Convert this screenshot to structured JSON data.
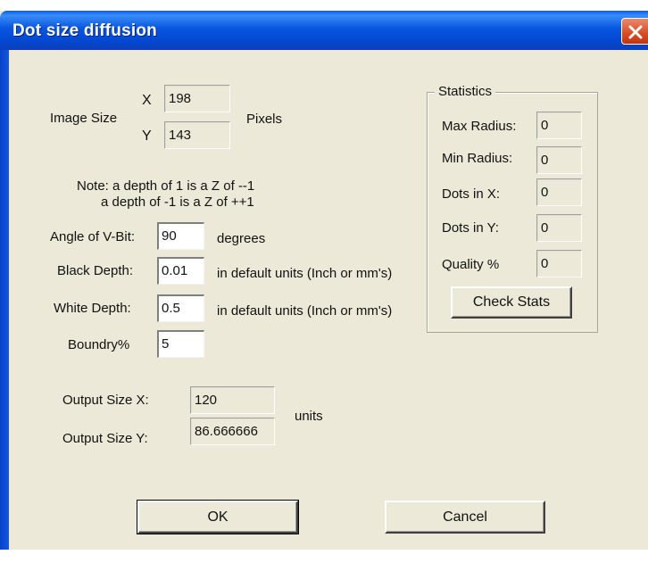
{
  "window": {
    "title": "Dot size diffusion"
  },
  "icons": {
    "close": "close-x-icon"
  },
  "image_size": {
    "label": "Image Size",
    "x_label": "X",
    "x_value": "198",
    "y_label": "Y",
    "y_value": "143",
    "unit": "Pixels"
  },
  "note": {
    "line1": "Note: a depth of 1 is a Z of --1",
    "line2": "a depth of -1 is a Z of ++1"
  },
  "params": {
    "angle_label": "Angle of V-Bit:",
    "angle_value": "90",
    "angle_unit": "degrees",
    "black_label": "Black Depth:",
    "black_value": "0.01",
    "black_unit": "in default units (Inch or mm's)",
    "white_label": "White Depth:",
    "white_value": "0.5",
    "white_unit": "in default units (Inch or mm's)",
    "boundry_label": "Boundry%",
    "boundry_value": "5"
  },
  "output": {
    "x_label": "Output Size X:",
    "x_value": "120",
    "y_label": "Output Size Y:",
    "y_value": "86.666666",
    "unit": "units"
  },
  "statistics": {
    "title": "Statistics",
    "max_radius_label": "Max Radius:",
    "max_radius_value": "0",
    "min_radius_label": "Min Radius:",
    "min_radius_value": "0",
    "dots_x_label": "Dots in X:",
    "dots_x_value": "0",
    "dots_y_label": "Dots in Y:",
    "dots_y_value": "0",
    "quality_label": "Quality %",
    "quality_value": "0",
    "check_button": "Check Stats"
  },
  "buttons": {
    "ok": "OK",
    "cancel": "Cancel"
  }
}
